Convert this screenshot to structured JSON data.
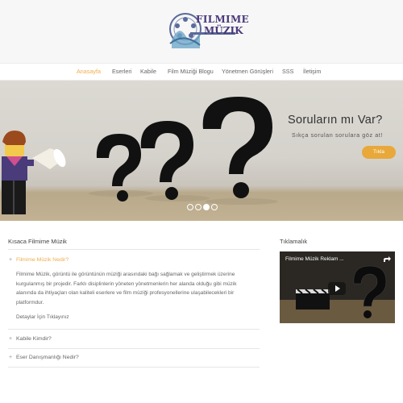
{
  "header": {
    "logo_title": "FILMIME",
    "logo_subtitle": "MÜZIK"
  },
  "nav": {
    "items": [
      "Anasayfa",
      "Eserleri",
      "Kabile",
      "Film Müziği Blogu",
      "Yönetmen Görüşleri",
      "SSS",
      "İletişim"
    ],
    "active_index": 0
  },
  "banner": {
    "title": "Soruların mı Var?",
    "subtitle": "Sıkça sorulan sorulara göz at!",
    "button": "Tıkla",
    "slide_count": 4,
    "active_slide": 2
  },
  "about": {
    "title": "Kısaca Filmime Müzik",
    "items": [
      {
        "label": "Filmime Müzik Nedir?",
        "open": true,
        "body": "Filmime Müzik, görüntü ile görüntünün müziği arasındaki bağı sağlamak ve geliştirmek üzerine kurgulanmış bir projedir. Farklı disiplinlerin yöneten yönetmenlerin her alanda olduğu gibi müzik alanında da ihtiyaçları olan kaliteli eserlere ve film müziği profesyonellerine ulaşabilecekleri bir platformdur.",
        "link": "Detaylar İçin Tıklayınız"
      },
      {
        "label": "Kabile Kimdir?",
        "open": false
      },
      {
        "label": "Eser Danışmanlığı Nedir?",
        "open": false
      }
    ]
  },
  "video": {
    "section_title": "Tıklamalık",
    "title": "Filmime Müzik Reklam ..."
  },
  "colors": {
    "accent": "#f0ad4e",
    "button": "#e8a83a"
  },
  "icons": {
    "plus": "+",
    "play": "play-icon",
    "share": "share-icon"
  }
}
